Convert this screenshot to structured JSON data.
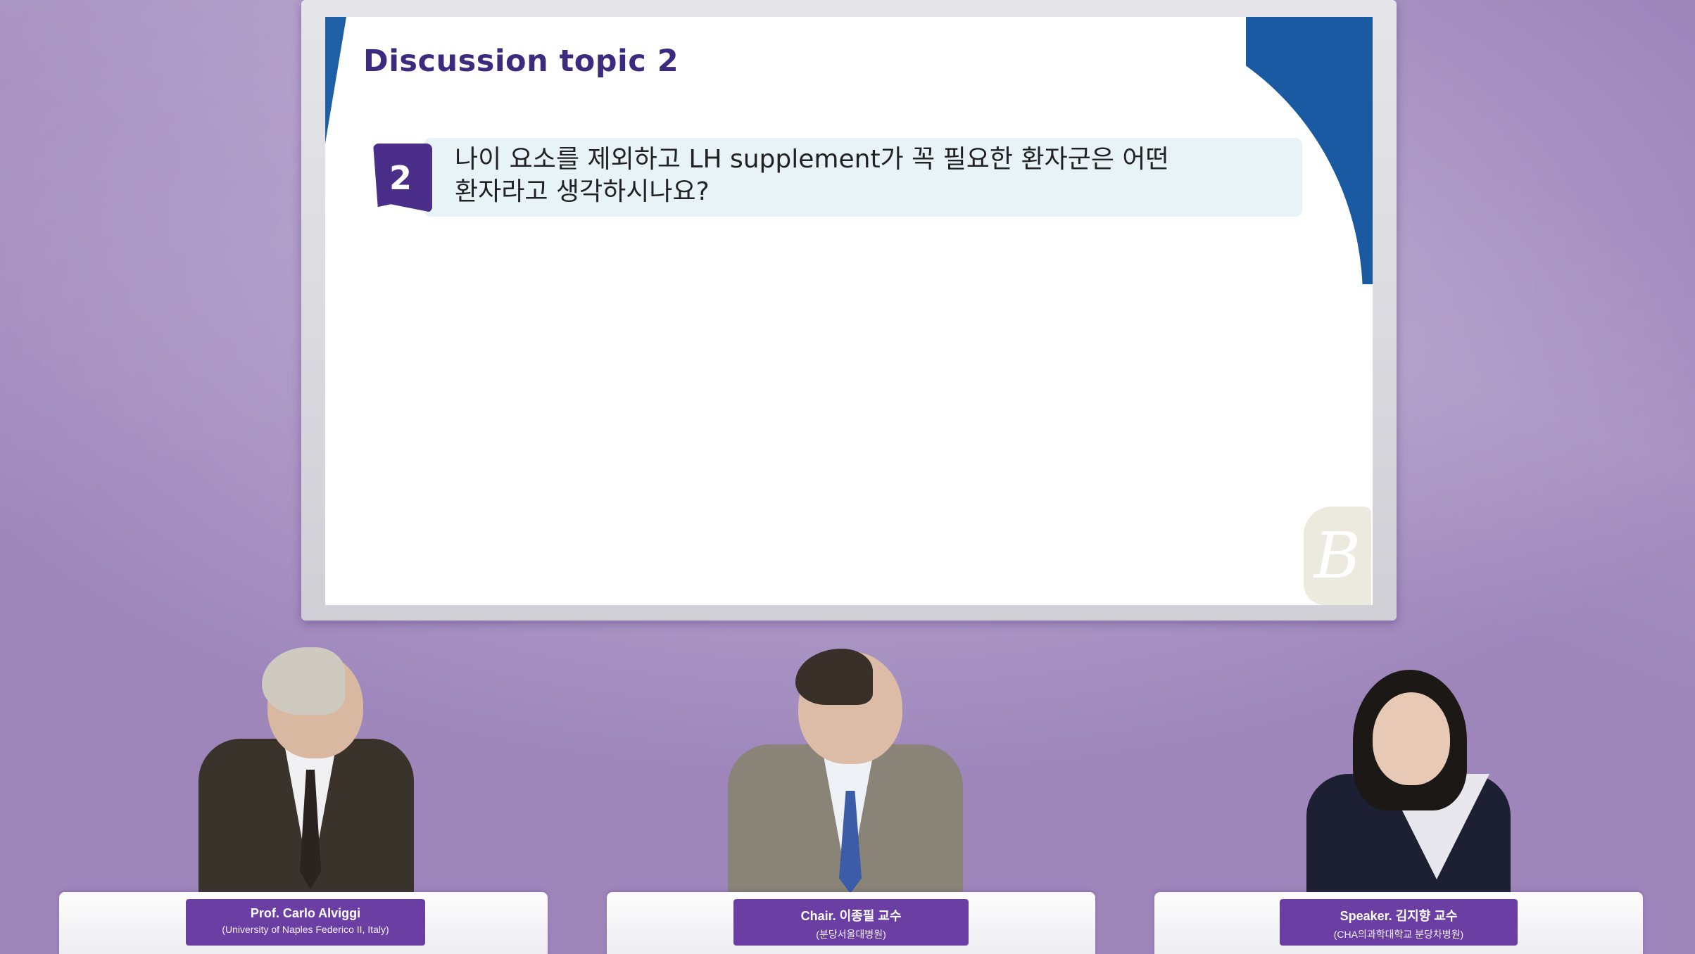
{
  "slide": {
    "title": "Discussion topic 2",
    "question_number": "2",
    "question_line1": "나이 요소를 제외하고 LH supplement가 꼭 필요한 환자군은 어떤",
    "question_line2": "환자라고 생각하시나요?",
    "logo_letter": "B"
  },
  "panelists": [
    {
      "line1": "Prof. Carlo Alviggi",
      "line2": "(University of Naples Federico II, Italy)"
    },
    {
      "line1": "Chair. 이종필 교수",
      "line2": "(분당서울대병원)"
    },
    {
      "line1": "Speaker. 김지향 교수",
      "line2": "(CHA의과학대학교 분당차병원)"
    }
  ],
  "colors": {
    "background": "#b3a0cb",
    "title": "#3b2a7e",
    "badge": "#4b2d8a",
    "slide_accent": "#1a5aa3",
    "nameplate": "#6a3ea3"
  }
}
